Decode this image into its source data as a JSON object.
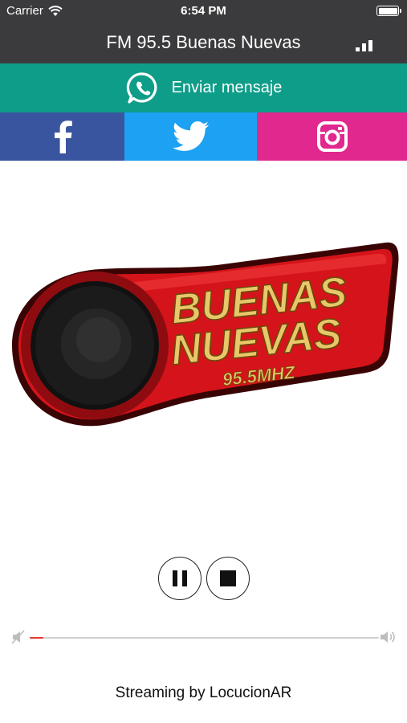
{
  "status_bar": {
    "carrier": "Carrier",
    "time": "6:54 PM"
  },
  "nav": {
    "title": "FM 95.5 Buenas Nuevas",
    "icon": "signal-bars-icon"
  },
  "whatsapp": {
    "label": "Enviar mensaje",
    "icon": "whatsapp-icon",
    "color": "#0e9d88"
  },
  "social": [
    {
      "name": "facebook",
      "icon": "facebook-icon",
      "color": "#3a559f"
    },
    {
      "name": "twitter",
      "icon": "twitter-icon",
      "color": "#1da1f2"
    },
    {
      "name": "instagram",
      "icon": "instagram-icon",
      "color": "#e1288f"
    }
  ],
  "logo": {
    "line1": "BUENAS",
    "line2": "NUEVAS",
    "frequency": "95.5MHZ",
    "color": "#d4141a"
  },
  "player": {
    "pause_icon": "pause-icon",
    "stop_icon": "stop-icon"
  },
  "volume": {
    "level": 0.01,
    "min_icon": "volume-mute-icon",
    "max_icon": "volume-max-icon"
  },
  "footer": {
    "text": "Streaming by LocucionAR"
  }
}
